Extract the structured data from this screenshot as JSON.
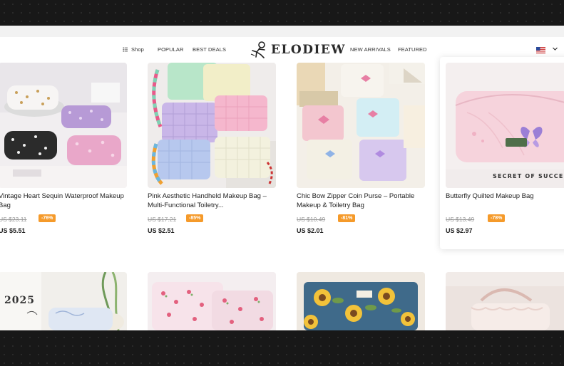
{
  "nav": {
    "shop": "Shop",
    "popular": "POPULAR",
    "best_deals": "BEST DEALS",
    "logo": "ELODIEW",
    "new_arrivals": "NEW ARRIVALS",
    "featured": "FEATURED"
  },
  "products": [
    {
      "title": "Vintage Heart Sequin Waterproof Makeup Bag",
      "original_price": "US $23.11",
      "discount": "-76%",
      "price": "US $5.51"
    },
    {
      "title": "Pink Aesthetic Handheld Makeup Bag – Multi-Functional Toiletry...",
      "original_price": "US $17.21",
      "discount": "-85%",
      "price": "US $2.51"
    },
    {
      "title": "Chic Bow Zipper Coin Purse – Portable Makeup & Toiletry Bag",
      "original_price": "US $10.49",
      "discount": "-81%",
      "price": "US $2.01"
    },
    {
      "title": "Butterfly Quilted Makeup Bag",
      "original_price": "US $13.49",
      "discount": "-78%",
      "price": "US $2.97",
      "image_caption": "SECRET OF SUCCE"
    }
  ],
  "second_row": {
    "calendar_text": "2025"
  }
}
